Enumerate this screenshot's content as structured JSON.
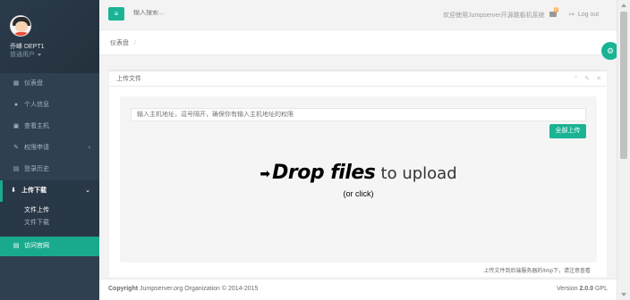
{
  "profile": {
    "name": "乔峰 DEPT1",
    "role": "普通用户"
  },
  "sidebar": {
    "items": [
      {
        "icon": "▦",
        "label": "仪表盘"
      },
      {
        "icon": "●",
        "label": "个人信息"
      },
      {
        "icon": "▣",
        "label": "查看主机"
      },
      {
        "icon": "✎",
        "label": "权限申请",
        "arrow": "‹"
      },
      {
        "icon": "▤",
        "label": "登录历史"
      },
      {
        "icon": "⬇",
        "label": "上传下载",
        "arrow": "⌄"
      }
    ],
    "sub_items": [
      {
        "label": "文件上传"
      },
      {
        "label": "文件下载"
      }
    ],
    "visit": {
      "icon": "▤",
      "label": "访问官网"
    }
  },
  "topbar": {
    "menu_icon": "≡",
    "search_placeholder": "输入搜索...",
    "welcome": "欢迎使用Jumpserver开源跳板机系统",
    "mail_badge": "0",
    "logout_icon": "↦",
    "logout": "Log out"
  },
  "breadcrumb": {
    "item": "仪表盘",
    "sep": "/"
  },
  "panel": {
    "title": "上传文件",
    "tools": {
      "collapse": "⌃",
      "config": "✎",
      "close": "✕"
    },
    "host_placeholder": "输入主机地址，逗号隔开，确保你有输入主机地址的权限",
    "upload_all": "全部上传",
    "dz_arrow": "➡",
    "dz_title_bold": "Drop files",
    "dz_title_thin": "to upload",
    "dz_sub": "(or click)",
    "note": "上传文件到后端服务器的/tmp下，请注意查看"
  },
  "footer": {
    "copyright_bold": "Copyright",
    "copyright_rest": "Jumpserver.org Organization © 2014-2015",
    "version_label": "Version",
    "version_num": "2.0.0",
    "version_suffix": "GPL"
  },
  "float_icon": "⚙",
  "colors": {
    "accent": "#1ab394",
    "sidebar": "#2f4050",
    "sidebar_dark": "#293846"
  }
}
